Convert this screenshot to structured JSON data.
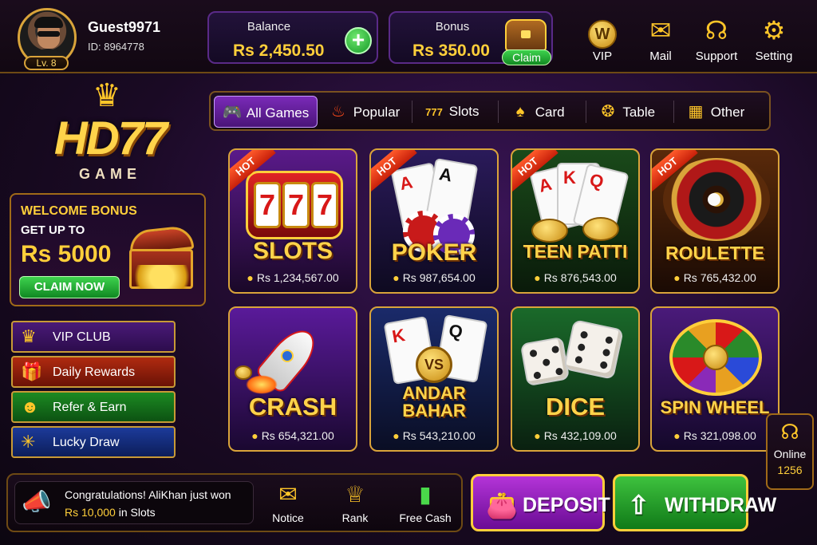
{
  "user": {
    "name": "Guest9971",
    "id": "ID: 8964778",
    "level": "Lv. 8"
  },
  "wallet": {
    "balance_label": "Balance",
    "balance_value": "Rs 2,450.50",
    "add_icon": "plus-icon",
    "bonus_label": "Bonus",
    "bonus_value": "Rs 350.00",
    "claim_label": "Claim"
  },
  "top_nav": [
    {
      "label": "VIP",
      "icon": "vip-coin-icon"
    },
    {
      "label": "Mail",
      "icon": "mail-icon"
    },
    {
      "label": "Support",
      "icon": "headset-icon"
    },
    {
      "label": "Setting",
      "icon": "gear-icon"
    }
  ],
  "logo": {
    "title": "HD77",
    "subtitle": "GAME"
  },
  "welcome": {
    "line1": "WELCOME BONUS",
    "line2": "GET UP TO",
    "amount": "Rs 5000",
    "button": "CLAIM NOW"
  },
  "side_menu": [
    {
      "label": "VIP CLUB",
      "icon": "crown-icon"
    },
    {
      "label": "Daily Rewards",
      "icon": "gift-icon"
    },
    {
      "label": "Refer & Earn",
      "icon": "users-icon"
    },
    {
      "label": "Lucky Draw",
      "icon": "wheel-icon"
    }
  ],
  "tabs": [
    {
      "label": "All Games",
      "icon": "gamepad-icon",
      "active": true
    },
    {
      "label": "Popular",
      "icon": "flame-icon"
    },
    {
      "label": "Slots",
      "icon": "slots-777-icon"
    },
    {
      "label": "Card",
      "icon": "cards-icon"
    },
    {
      "label": "Table",
      "icon": "chip-icon"
    },
    {
      "label": "Other",
      "icon": "grid-icon"
    }
  ],
  "games": [
    {
      "name": "SLOTS",
      "players": "Rs 1,234,567.00",
      "hot": "HOT"
    },
    {
      "name": "POKER",
      "players": "Rs 987,654.00",
      "hot": "HOT"
    },
    {
      "name": "TEEN PATTI",
      "players": "Rs 876,543.00",
      "hot": "HOT"
    },
    {
      "name": "ROULETTE",
      "players": "Rs 765,432.00",
      "hot": "HOT"
    },
    {
      "name": "CRASH",
      "players": "Rs 654,321.00"
    },
    {
      "name": "ANDAR",
      "name2": "BAHAR",
      "players": "Rs 543,210.00",
      "vs": "VS"
    },
    {
      "name": "DICE",
      "players": "Rs 432,109.00"
    },
    {
      "name": "SPIN WHEEL",
      "players": "Rs 321,098.00"
    }
  ],
  "card_labels": {
    "slots_reel": "7",
    "poker_a": "A",
    "teen_a": "A",
    "teen_k": "K",
    "teen_q": "Q",
    "andar_k": "K",
    "andar_q": "Q"
  },
  "online": {
    "label": "Online",
    "count": "1256"
  },
  "notice": {
    "line1": "Congratulations! AliKhan just won",
    "amount": "Rs 10,000",
    "line2_suffix": " in Slots"
  },
  "footer_nav": [
    {
      "label": "Notice",
      "icon": "notice-icon"
    },
    {
      "label": "Rank",
      "icon": "trophy-icon"
    },
    {
      "label": "Free Cash",
      "icon": "cash-icon"
    }
  ],
  "actions": {
    "deposit": "DEPOSIT",
    "withdraw": "WITHDRAW"
  }
}
